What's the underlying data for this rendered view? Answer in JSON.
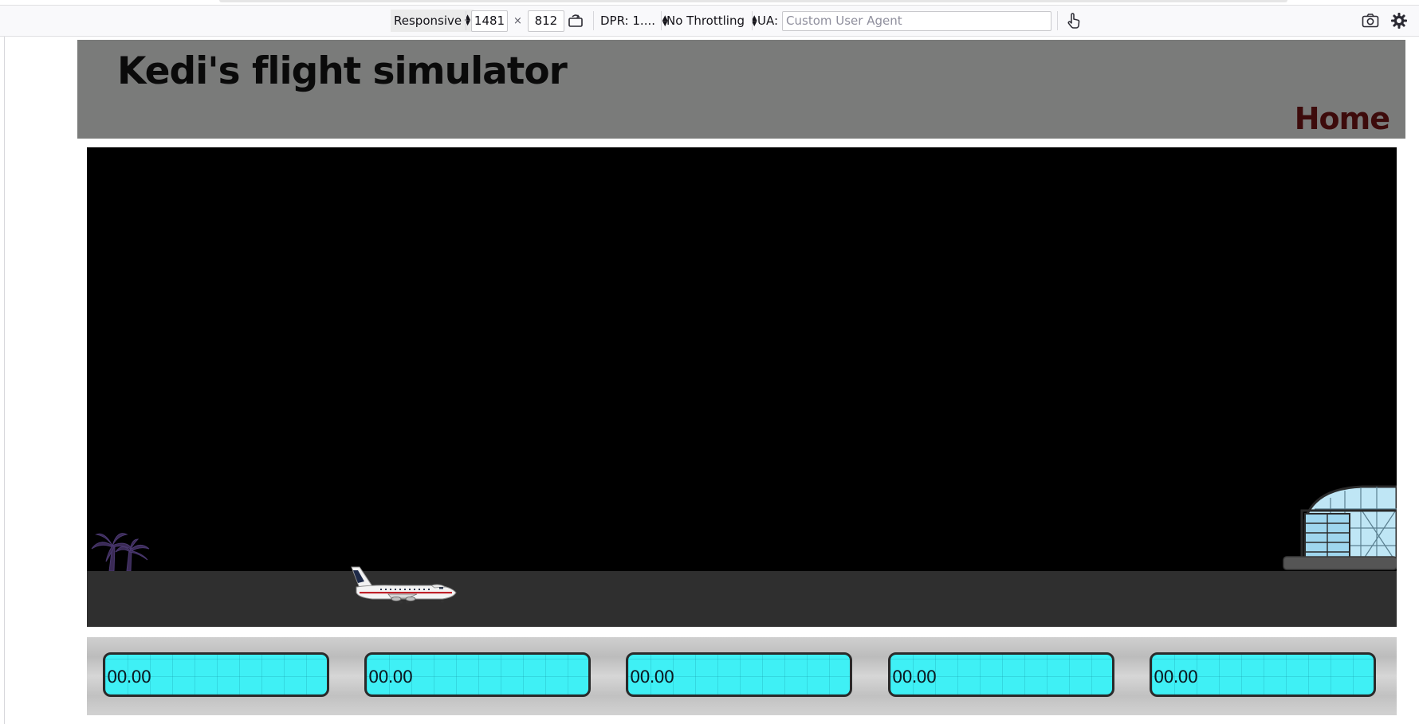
{
  "devtools": {
    "device_select": "Responsive",
    "width_value": "1481",
    "times_sign": "×",
    "height_value": "812",
    "dpr_label": "DPR: 1....",
    "throttling_label": "No Throttling",
    "ua_label": "UA:",
    "ua_placeholder": "Custom User Agent",
    "icons": [
      "rotate-icon",
      "touch-simulation-icon",
      "screenshot-icon",
      "settings-icon"
    ]
  },
  "header": {
    "title": "Kedi's flight simulator",
    "home_link": "Home",
    "background": "#7a7b7a"
  },
  "scene": {
    "sky_color": "#000000",
    "ground_color": "#2f2f2f",
    "objects": [
      "palm-trees",
      "airplane",
      "terminal-building"
    ]
  },
  "instruments": [
    {
      "value": "00.00"
    },
    {
      "value": "00.00"
    },
    {
      "value": "00.00"
    },
    {
      "value": "00.00"
    },
    {
      "value": "00.00"
    }
  ],
  "colors": {
    "gauge_fill": "#3ff0f5",
    "home_link": "#3d0b0b"
  }
}
